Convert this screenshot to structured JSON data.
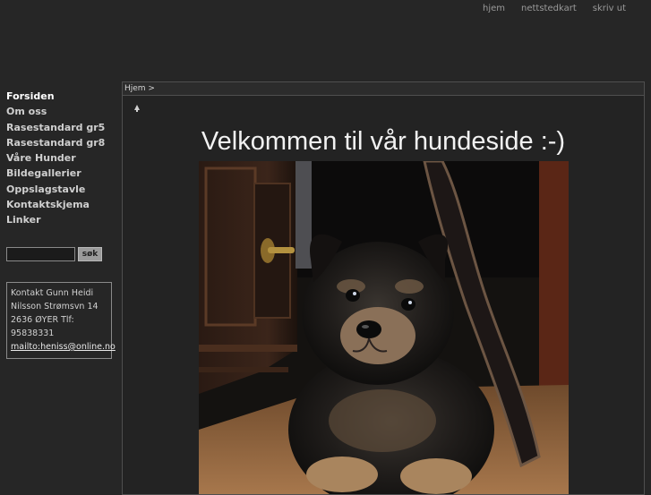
{
  "topnav": {
    "home": "hjem",
    "sitemap": "nettstedkart",
    "print": "skriv ut"
  },
  "menu": [
    "Forsiden",
    "Om oss",
    "Rasestandard gr5",
    "Rasestandard gr8",
    "Våre Hunder",
    "Bildegallerier",
    "Oppslagstavle",
    "Kontaktskjema",
    "Linker"
  ],
  "search": {
    "value": "",
    "button_label": "søk"
  },
  "contact": {
    "text": "Kontakt Gunn Heidi Nilsson Strømsvn 14 2636 ØYER Tlf: 95838331",
    "email_link": "mailto:heniss@online.no"
  },
  "breadcrumb": "Hjem >",
  "main": {
    "heading": "Velkommen til vår hundeside :-)"
  },
  "colors": {
    "background": "#262626",
    "menu_active": "#ffffff",
    "menu_text": "#cfcfcf"
  }
}
